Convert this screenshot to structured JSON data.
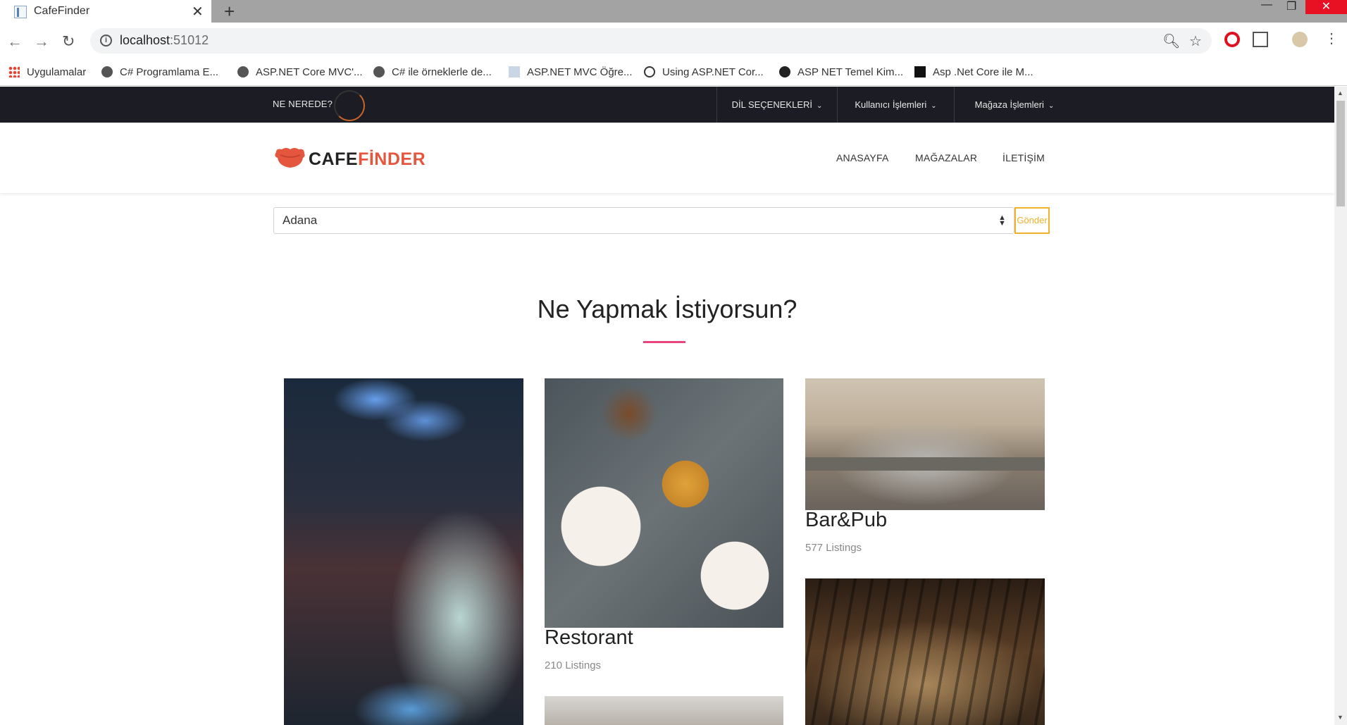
{
  "browser": {
    "tab_title": "CafeFinder",
    "url_host": "localhost",
    "url_port": ":51012",
    "bookmarks": [
      "Uygulamalar",
      "C# Programlama E...",
      "ASP.NET Core MVC'...",
      "C# ile örneklerle de...",
      "ASP.NET MVC Öğre...",
      "Using ASP.NET Cor...",
      "ASP NET Temel Kim...",
      "Asp .Net Core ile M..."
    ]
  },
  "topbar": {
    "brand": "NE NEREDE?",
    "menus": [
      "DİL SEÇENEKLERİ",
      "Kullanıcı İşlemleri",
      "Mağaza İşlemleri"
    ]
  },
  "nav": {
    "logo_part1": "CAFE",
    "logo_part2": "FİNDER",
    "links": [
      "ANASAYFA",
      "MAĞAZALAR",
      "İLETİŞİM"
    ]
  },
  "search": {
    "selected_city": "Adana",
    "submit_label": "Gönder"
  },
  "section": {
    "title": "Ne Yapmak İstiyorsun?"
  },
  "categories": [
    {
      "name": "Restorant",
      "count": "210 Listings"
    },
    {
      "name": "Bar&Pub",
      "count": "577 Listings"
    }
  ],
  "colors": {
    "accent": "#e5563f",
    "title_underline": "#e8467b",
    "submit_border": "#f0b12b",
    "topbar_bg": "#1c1d24"
  }
}
